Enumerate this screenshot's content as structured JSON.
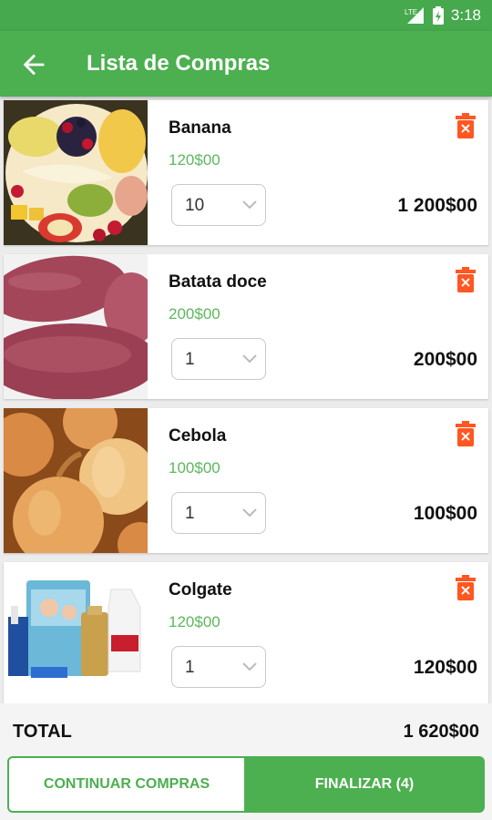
{
  "status_bar": {
    "signal_label": "LTE",
    "time": "3:18"
  },
  "app_bar": {
    "title": "Lista de Compras",
    "back_icon": "arrow-left-icon"
  },
  "colors": {
    "primary": "#4caf50",
    "unit_price": "#5cb85c",
    "delete": "#ff5722"
  },
  "items": [
    {
      "name": "Banana",
      "unit_price": "120$00",
      "quantity": "10",
      "line_total": "1 200$00",
      "image": "fruit-bowl-image"
    },
    {
      "name": "Batata doce",
      "unit_price": "200$00",
      "quantity": "1",
      "line_total": "200$00",
      "image": "sweet-potato-image"
    },
    {
      "name": "Cebola",
      "unit_price": "100$00",
      "quantity": "1",
      "line_total": "100$00",
      "image": "onion-image"
    },
    {
      "name": "Colgate",
      "unit_price": "120$00",
      "quantity": "1",
      "line_total": "120$00",
      "image": "toiletries-image"
    }
  ],
  "footer": {
    "total_label": "TOTAL",
    "total_value": "1 620$00",
    "continue_label": "CONTINUAR COMPRAS",
    "finish_label": "FINALIZAR (4)"
  }
}
